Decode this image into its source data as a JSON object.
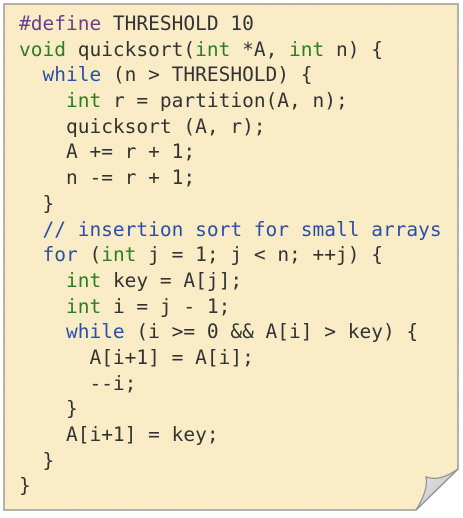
{
  "colors": {
    "paper": "#fcefc9",
    "paper_border": "#9a9a9a",
    "text": "#333333",
    "preprocessor": "#6e3c8e",
    "keyword": "#2b4fa8",
    "type": "#2f7d23",
    "comment": "#2b4fa8"
  },
  "code": {
    "lines": [
      {
        "indent": "",
        "tokens": [
          {
            "c": "pp",
            "t": "#define"
          },
          {
            "c": "op",
            "t": " THRESHOLD 10"
          }
        ]
      },
      {
        "indent": "",
        "tokens": [
          {
            "c": "ty",
            "t": "void"
          },
          {
            "c": "op",
            "t": " quicksort("
          },
          {
            "c": "ty",
            "t": "int"
          },
          {
            "c": "op",
            "t": " *A, "
          },
          {
            "c": "ty",
            "t": "int"
          },
          {
            "c": "op",
            "t": " n) {"
          }
        ]
      },
      {
        "indent": "  ",
        "tokens": [
          {
            "c": "kw",
            "t": "while"
          },
          {
            "c": "op",
            "t": " (n > THRESHOLD) {"
          }
        ]
      },
      {
        "indent": "    ",
        "tokens": [
          {
            "c": "ty",
            "t": "int"
          },
          {
            "c": "op",
            "t": " r = partition(A, n);"
          }
        ]
      },
      {
        "indent": "    ",
        "tokens": [
          {
            "c": "op",
            "t": "quicksort (A, r);"
          }
        ]
      },
      {
        "indent": "    ",
        "tokens": [
          {
            "c": "op",
            "t": "A += r + 1;"
          }
        ]
      },
      {
        "indent": "    ",
        "tokens": [
          {
            "c": "op",
            "t": "n -= r + 1;"
          }
        ]
      },
      {
        "indent": "  ",
        "tokens": [
          {
            "c": "op",
            "t": "}"
          }
        ]
      },
      {
        "indent": "  ",
        "tokens": [
          {
            "c": "cm",
            "t": "// insertion sort for small arrays"
          }
        ]
      },
      {
        "indent": "  ",
        "tokens": [
          {
            "c": "kw",
            "t": "for"
          },
          {
            "c": "op",
            "t": " ("
          },
          {
            "c": "ty",
            "t": "int"
          },
          {
            "c": "op",
            "t": " j = 1; j < n; ++j) {"
          }
        ]
      },
      {
        "indent": "    ",
        "tokens": [
          {
            "c": "ty",
            "t": "int"
          },
          {
            "c": "op",
            "t": " key = A[j];"
          }
        ]
      },
      {
        "indent": "    ",
        "tokens": [
          {
            "c": "ty",
            "t": "int"
          },
          {
            "c": "op",
            "t": " i = j - 1;"
          }
        ]
      },
      {
        "indent": "    ",
        "tokens": [
          {
            "c": "kw",
            "t": "while"
          },
          {
            "c": "op",
            "t": " (i >= 0 && A[i] > key) {"
          }
        ]
      },
      {
        "indent": "      ",
        "tokens": [
          {
            "c": "op",
            "t": "A[i+1] = A[i];"
          }
        ]
      },
      {
        "indent": "      ",
        "tokens": [
          {
            "c": "op",
            "t": "--i;"
          }
        ]
      },
      {
        "indent": "    ",
        "tokens": [
          {
            "c": "op",
            "t": "}"
          }
        ]
      },
      {
        "indent": "    ",
        "tokens": [
          {
            "c": "op",
            "t": "A[i+1] = key;"
          }
        ]
      },
      {
        "indent": "  ",
        "tokens": [
          {
            "c": "op",
            "t": "}"
          }
        ]
      },
      {
        "indent": "",
        "tokens": [
          {
            "c": "op",
            "t": "}"
          }
        ]
      }
    ]
  }
}
